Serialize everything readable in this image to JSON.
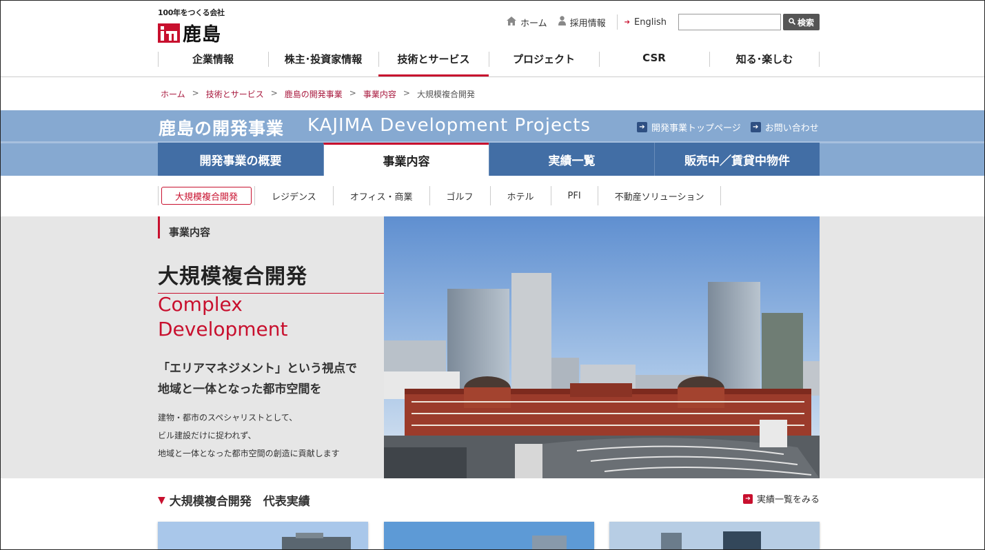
{
  "header": {
    "logo_tagline": "100年をつくる会社",
    "logo_name": "鹿島",
    "util": {
      "home": "ホーム",
      "recruit": "採用情報",
      "english": "English",
      "search_button": "検索",
      "search_placeholder": ""
    },
    "gnav": [
      {
        "label": "企業情報"
      },
      {
        "label": "株主･投資家情報"
      },
      {
        "label": "技術とサービス"
      },
      {
        "label": "プロジェクト"
      },
      {
        "label": "CSR"
      },
      {
        "label": "知る･楽しむ"
      }
    ]
  },
  "breadcrumb": {
    "items": [
      "ホーム",
      "技術とサービス",
      "鹿島の開発事業",
      "事業内容"
    ],
    "current": "大規模複合開発",
    "separator": ">"
  },
  "section": {
    "title": "鹿島の開発事業",
    "subtitle": "KAJIMA Development Projects",
    "links": [
      "開発事業トップページ",
      "お問い合わせ"
    ],
    "tabs": [
      "開発事業の概要",
      "事業内容",
      "実績一覧",
      "販売中／賃貸中物件"
    ]
  },
  "subnav": [
    "大規模複合開発",
    "レジデンス",
    "オフィス・商業",
    "ゴルフ",
    "ホテル",
    "PFI",
    "不動産ソリューション"
  ],
  "hero": {
    "label": "事業内容",
    "title": "大規模複合開発",
    "title_en_1": "Complex",
    "title_en_2": "Development",
    "lead_1": "「エリアマネジメント」という視点で",
    "lead_2": "地域と一体となった都市空間を",
    "body_1": "建物・都市のスペシャリストとして、",
    "body_2": "ビル建設だけに捉われず、",
    "body_3": "地域と一体となった都市空間の創造に貢献します"
  },
  "representative": {
    "heading": "大規模複合開発　代表実績",
    "more_link": "実績一覧をみる"
  },
  "colors": {
    "accent": "#c8102e",
    "band": "#86a9d1",
    "tab": "#426ea5"
  },
  "icons": {
    "home": "home-icon",
    "recruit": "person-icon",
    "english": "arrow-right-icon",
    "search": "magnifier-icon"
  }
}
